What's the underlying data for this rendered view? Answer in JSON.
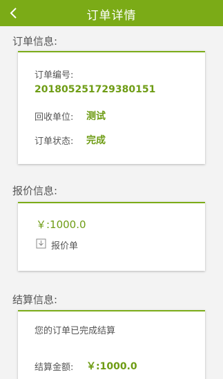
{
  "header": {
    "title": "订单详情",
    "back_icon": "chevron-left-icon"
  },
  "order_info": {
    "section_title": "订单信息:",
    "order_no_label": "订单编号:",
    "order_no_value": "201805251729380151",
    "recycler_label": "回收单位:",
    "recycler_value": "测试",
    "status_label": "订单状态:",
    "status_value": "完成"
  },
  "quote_info": {
    "section_title": "报价信息:",
    "price": "￥:1000.0",
    "quote_doc_label": "报价单",
    "quote_doc_icon": "download-icon"
  },
  "settlement_info": {
    "section_title": "结算信息:",
    "message": "您的订单已完成结算",
    "amount_label": "结算金额:",
    "amount_value": "￥:1000.0"
  },
  "colors": {
    "accent": "#7bab17",
    "value_green": "#6e9c14",
    "background": "#f3f3f3"
  }
}
